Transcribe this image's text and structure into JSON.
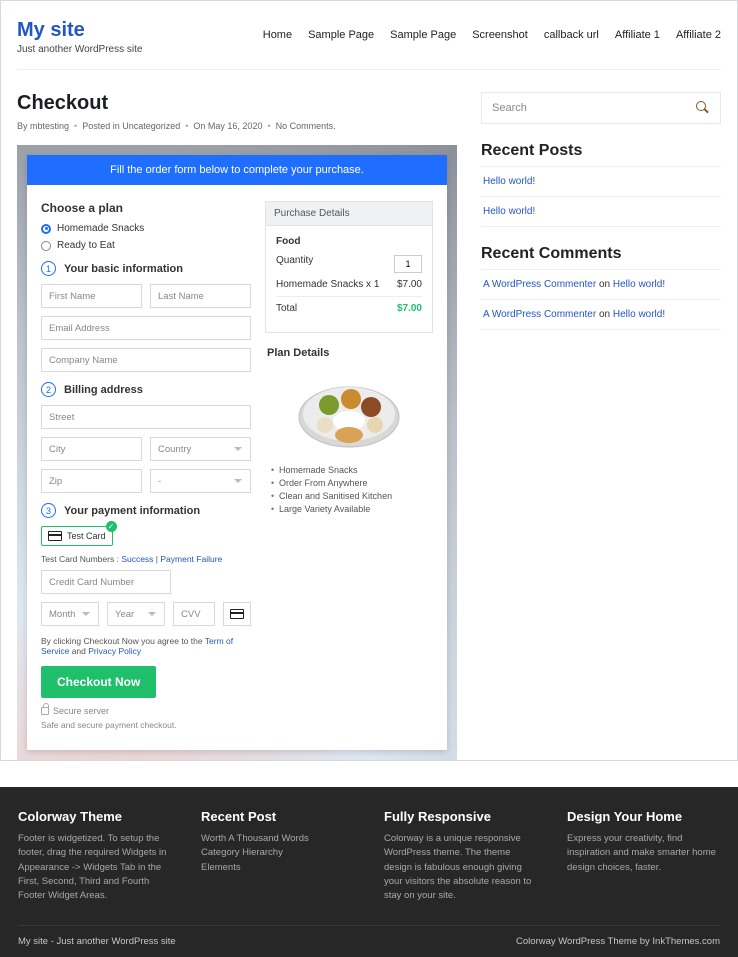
{
  "header": {
    "site_title": "My site",
    "tagline": "Just another WordPress site",
    "nav": [
      "Home",
      "Sample Page",
      "Sample Page",
      "Screenshot",
      "callback url",
      "Affiliate 1",
      "Affiliate 2"
    ]
  },
  "page": {
    "title": "Checkout",
    "meta_author": "By mbtesting",
    "meta_cat": "Posted in Uncategorized",
    "meta_date": "On May 16, 2020",
    "meta_comments": "No Comments."
  },
  "checkout": {
    "banner": "Fill the order form below to complete your purchase.",
    "choose_label": "Choose a plan",
    "plans": {
      "p1": "Homemade Snacks",
      "p2": "Ready to Eat"
    },
    "s1": "Your basic information",
    "s2": "Billing address",
    "s3": "Your payment information",
    "ph": {
      "first": "First Name",
      "last": "Last Name",
      "email": "Email Address",
      "company": "Company Name",
      "street": "Street",
      "city": "City",
      "country": "Country",
      "zip": "Zip",
      "state": "-",
      "cc": "Credit Card Number",
      "month": "Month",
      "year": "Year",
      "cvv": "CVV"
    },
    "testcard_label": "Test Card",
    "testnums_pre": "Test Card Numbers : ",
    "testnums_a": "Success",
    "testnums_sep": " | ",
    "testnums_b": "Payment Failure",
    "agree_pre": "By clicking Checkout Now you agree to the ",
    "agree_tos": "Term of Service",
    "agree_and": " and ",
    "agree_pp": "Privacy Policy",
    "button": "Checkout Now",
    "secure1": "Secure server",
    "secure2": "Safe and secure payment checkout."
  },
  "summary": {
    "header": "Purchase Details",
    "food": "Food",
    "quantity_label": "Quantity",
    "quantity_value": "1",
    "line_label": "Homemade Snacks x 1",
    "line_price": "$7.00",
    "total_label": "Total",
    "total_price": "$7.00",
    "plan_details": "Plan Details",
    "bullets": [
      "Homemade Snacks",
      "Order From Anywhere",
      "Clean and Sanitised Kitchen",
      "Large Variety Available"
    ]
  },
  "sidebar": {
    "search_placeholder": "Search",
    "recent_posts_h": "Recent Posts",
    "recent_posts": [
      "Hello world!",
      "Hello world!"
    ],
    "recent_comments_h": "Recent Comments",
    "rc": [
      {
        "who": "A WordPress Commenter",
        "on": " on ",
        "post": "Hello world!"
      },
      {
        "who": "A WordPress Commenter",
        "on": " on ",
        "post": "Hello world!"
      }
    ]
  },
  "footer": {
    "c1h": "Colorway Theme",
    "c1p": "Footer is widgetized. To setup the footer, drag the required Widgets in Appearance -> Widgets Tab in the First, Second, Third and Fourth Footer Widget Areas.",
    "c2h": "Recent Post",
    "c2l": [
      "Worth A Thousand Words",
      "Category Hierarchy",
      "Elements"
    ],
    "c3h": "Fully Responsive",
    "c3p": "Colorway is a unique responsive WordPress theme. The theme design is fabulous enough giving your visitors the absolute reason to stay on your site.",
    "c4h": "Design Your Home",
    "c4p": "Express your creativity, find inspiration and make smarter home design choices, faster.",
    "bar_l": "My site - Just another WordPress site",
    "bar_r": "Colorway WordPress Theme by InkThemes.com"
  }
}
